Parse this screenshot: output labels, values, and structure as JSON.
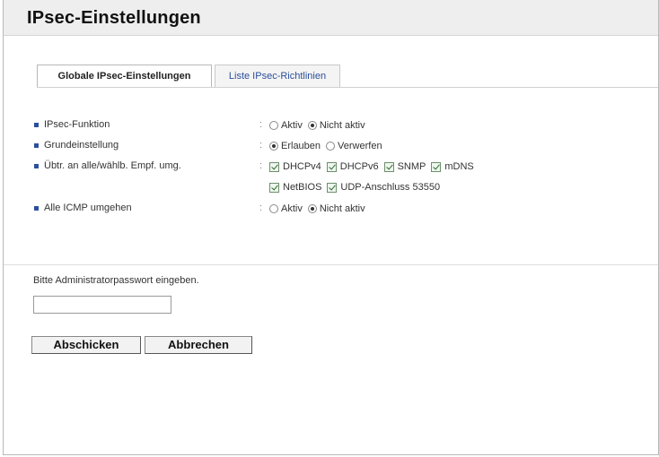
{
  "page": {
    "title": "IPsec-Einstellungen"
  },
  "tabs": [
    {
      "label": "Globale IPsec-Einstellungen",
      "active": true
    },
    {
      "label": "Liste IPsec-Richtlinien",
      "active": false
    }
  ],
  "settings": {
    "separator": ":",
    "ipsec_function": {
      "label": "IPsec-Funktion",
      "options": [
        {
          "label": "Aktiv",
          "selected": false
        },
        {
          "label": "Nicht aktiv",
          "selected": true
        }
      ]
    },
    "default_setting": {
      "label": "Grundeinstellung",
      "options": [
        {
          "label": "Erlauben",
          "selected": true
        },
        {
          "label": "Verwerfen",
          "selected": false
        }
      ]
    },
    "bypass": {
      "label": "Übtr. an alle/wählb. Empf. umg.",
      "checks": [
        {
          "label": "DHCPv4",
          "checked": true
        },
        {
          "label": "DHCPv6",
          "checked": true
        },
        {
          "label": "SNMP",
          "checked": true
        },
        {
          "label": "mDNS",
          "checked": true
        },
        {
          "label": "NetBIOS",
          "checked": true
        },
        {
          "label": "UDP-Anschluss 53550",
          "checked": true
        }
      ]
    },
    "icmp_bypass": {
      "label": "Alle ICMP umgehen",
      "options": [
        {
          "label": "Aktiv",
          "selected": false
        },
        {
          "label": "Nicht aktiv",
          "selected": true
        }
      ]
    }
  },
  "password": {
    "prompt": "Bitte Administratorpasswort eingeben.",
    "value": ""
  },
  "buttons": {
    "submit": "Abschicken",
    "cancel": "Abbrechen"
  }
}
